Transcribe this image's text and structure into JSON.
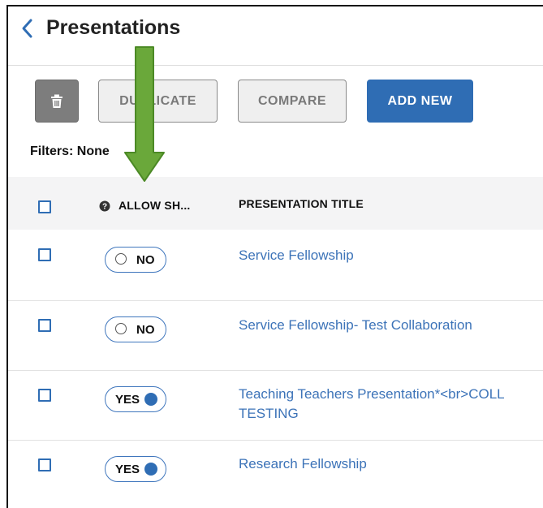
{
  "header": {
    "title": "Presentations",
    "back_icon": "chevron-left-icon"
  },
  "toolbar": {
    "delete_icon": "trash-icon",
    "duplicate_label": "DUPLICATE",
    "compare_label": "COMPARE",
    "add_new_label": "ADD NEW"
  },
  "filters": {
    "label": "Filters: None"
  },
  "table": {
    "columns": {
      "allow_share": "ALLOW SH...",
      "title": "PRESENTATION TITLE"
    },
    "rows": [
      {
        "allow_share": "NO",
        "title": "Service Fellowship"
      },
      {
        "allow_share": "NO",
        "title": "Service Fellowship- Test Collaboration"
      },
      {
        "allow_share": "YES",
        "title": "Teaching Teachers Presentation*<br>COLL",
        "title_line2": "TESTING"
      },
      {
        "allow_share": "YES",
        "title": "Research Fellowship"
      }
    ]
  },
  "colors": {
    "accent": "#2f6db4",
    "link": "#3c73b8",
    "arrow": "#6aa83a"
  },
  "annotation": {
    "arrow_icon": "down-arrow-icon"
  }
}
